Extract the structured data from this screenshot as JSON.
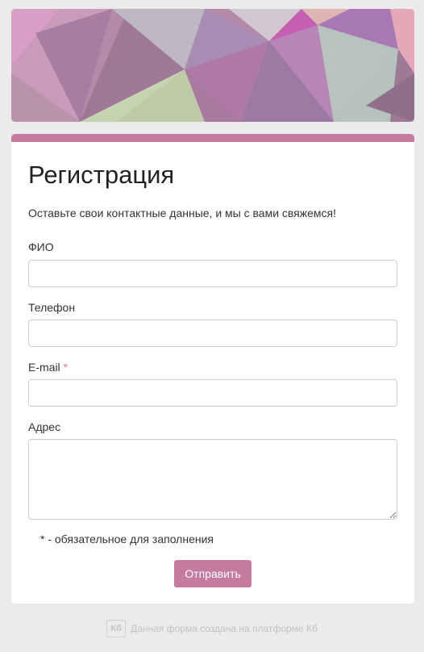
{
  "form": {
    "title": "Регистрация",
    "subtitle": "Оставьте свои контактные данные, и мы с вами свяжемся!",
    "fields": [
      {
        "label": "ФИО",
        "required": false,
        "value": "",
        "placeholder": ""
      },
      {
        "label": "Телефон",
        "required": false,
        "value": "",
        "placeholder": ""
      },
      {
        "label": "E-mail",
        "required": true,
        "value": "",
        "placeholder": ""
      },
      {
        "label": "Адрес",
        "required": false,
        "value": "",
        "placeholder": ""
      }
    ],
    "required_mark": "*",
    "required_note": "* - обязательное для заполнения",
    "submit_label": "Отправить"
  },
  "footer": {
    "logo_text": "Кб",
    "text": "Данная форма создана на платформе Кб"
  },
  "colors": {
    "accent": "#c57a9f",
    "background": "#ebebeb"
  }
}
